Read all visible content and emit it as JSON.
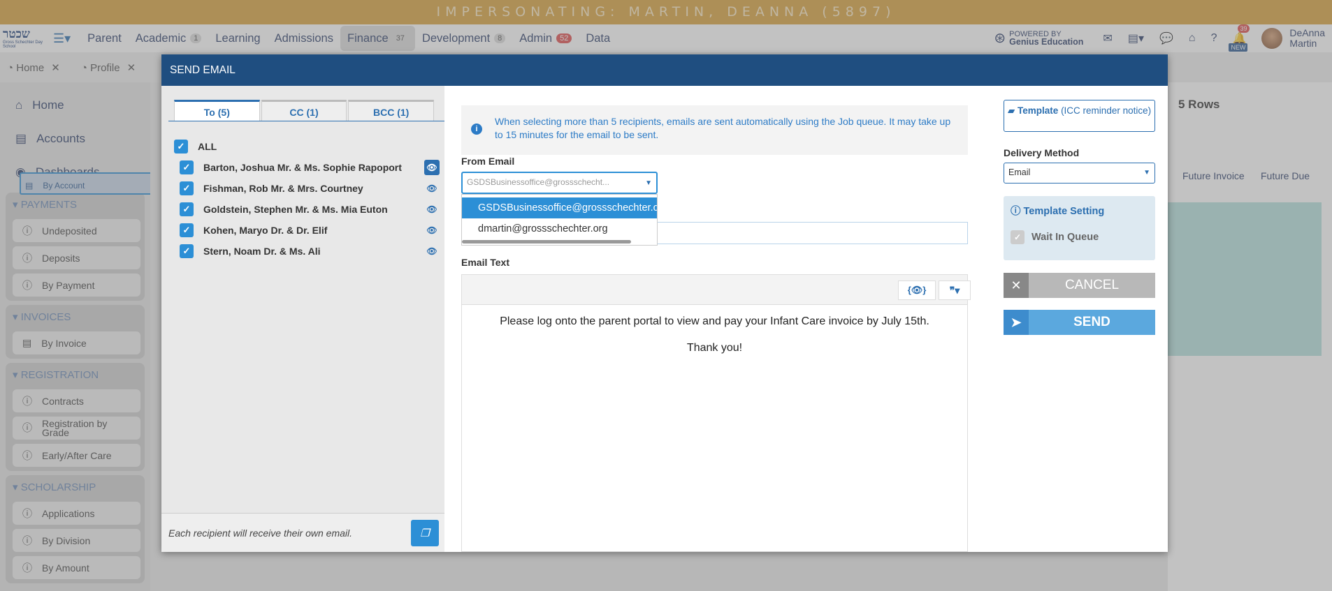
{
  "impersonation_banner": "IMPERSONATING: MARTIN, DEANNA (5897)",
  "logo": {
    "text": "שכטר",
    "subtext": "Gross Schechter Day School"
  },
  "nav": [
    {
      "label": "Parent",
      "badge": ""
    },
    {
      "label": "Academic",
      "badge": "1"
    },
    {
      "label": "Learning",
      "badge": ""
    },
    {
      "label": "Admissions",
      "badge": ""
    },
    {
      "label": "Finance",
      "badge": "37"
    },
    {
      "label": "Development",
      "badge": "8"
    },
    {
      "label": "Admin",
      "badge": "52"
    },
    {
      "label": "Data",
      "badge": ""
    }
  ],
  "powered_by": {
    "line1": "POWERED BY",
    "line2": "Genius Education"
  },
  "notifications": {
    "count": "39",
    "new_label": "NEW"
  },
  "user": {
    "first": "DeAnna",
    "last": "Martin"
  },
  "tabs": [
    "Home",
    "Profile"
  ],
  "sidebar": {
    "home": "Home",
    "accounts": "Accounts",
    "dashboards": "Dashboards",
    "sections": [
      {
        "title": "PAYMENTS",
        "items": [
          "Undeposited",
          "Deposits",
          "By Payment"
        ]
      },
      {
        "title": "INVOICES",
        "items": [
          "By Account",
          "By Invoice"
        ]
      },
      {
        "title": "REGISTRATION",
        "items": [
          "Contracts",
          "Registration by Grade",
          "Early/After Care"
        ]
      },
      {
        "title": "SCHOLARSHIP",
        "items": [
          "Applications",
          "By Division",
          "By Amount"
        ]
      }
    ]
  },
  "background": {
    "rows_label": "5 Rows",
    "col1": "Future Invoice",
    "col2": "Future Due"
  },
  "modal": {
    "title": "SEND EMAIL",
    "recipient_tabs": [
      "To (5)",
      "CC (1)",
      "BCC (1)"
    ],
    "all_label": "ALL",
    "recipients": [
      "Barton, Joshua Mr. & Ms. Sophie Rapoport",
      "Fishman, Rob Mr. & Mrs. Courtney",
      "Goldstein, Stephen Mr. & Ms. Mia Euton",
      "Kohen, Maryo Dr. & Dr. Elif",
      "Stern, Noam Dr. & Ms. Ali"
    ],
    "footer_note": "Each recipient will receive their own email.",
    "info_text": "When selecting more than 5 recipients, emails are sent automatically using the Job queue. It may take up to 15 minutes for the email to be sent.",
    "from_email_label": "From Email",
    "from_email_value": "GSDSBusinessoffice@grossschecht...",
    "from_email_options": [
      "GSDSBusinessoffice@grossschechter.org",
      "dmartin@grossschechter.org"
    ],
    "email_text_label": "Email Text",
    "toolbar": {
      "preview": "{👁}",
      "quote": "❞▾"
    },
    "body_lines": [
      "Please log onto the parent portal to view and pay your Infant Care invoice by July 15th.",
      "Thank you!"
    ],
    "template_label": "Template",
    "template_name": "(ICC reminder notice)",
    "delivery_label": "Delivery Method",
    "delivery_value": "Email",
    "template_setting": "Template Setting",
    "wait_in_queue": "Wait In Queue",
    "cancel_label": "CANCEL",
    "send_label": "SEND"
  }
}
